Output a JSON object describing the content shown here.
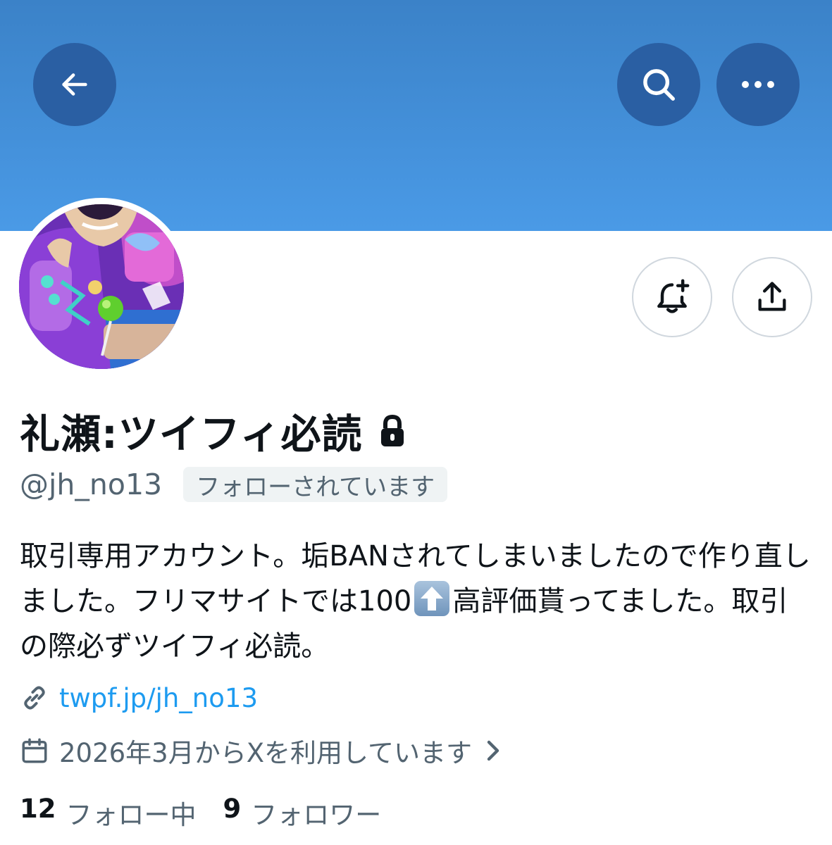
{
  "header": {
    "back_icon": "arrow-left-icon",
    "search_icon": "search-icon",
    "more_icon": "more-horizontal-icon",
    "banner_color": "#4a9ae6",
    "button_color": "#2a5fa3"
  },
  "profile": {
    "display_name": "礼瀬:ツイフィ必読",
    "protected_icon": "lock-icon",
    "handle": "@jh_no13",
    "follows_you_badge": "フォローされています",
    "notify_icon": "bell-plus-icon",
    "share_icon": "share-icon",
    "bio": {
      "part1": "取引専用アカウント。垢BANされてしまいましたので作り直しました。フリマサイトでは100",
      "emoji": "up-arrow-emoji",
      "part2": "高評価貰ってました。取引の際必ずツイフィ必読。"
    },
    "link": {
      "icon": "link-icon",
      "text": "twpf.jp/jh_no13"
    },
    "joined": {
      "icon": "calendar-icon",
      "text": "2026年3月からXを利用しています"
    },
    "stats": {
      "following_count": "12",
      "following_label": "フォロー中",
      "followers_count": "9",
      "followers_label": "フォロワー"
    }
  },
  "colors": {
    "link": "#1d9bf0",
    "secondary_text": "#536471",
    "primary_text": "#0f1419"
  }
}
